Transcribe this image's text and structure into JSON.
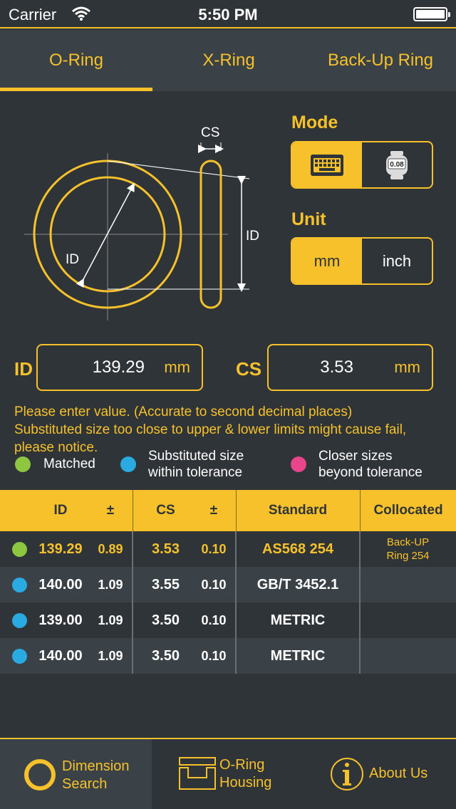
{
  "status_bar": {
    "carrier": "Carrier",
    "time": "5:50 PM"
  },
  "tabs": [
    {
      "label": "O-Ring",
      "active": true
    },
    {
      "label": "X-Ring",
      "active": false
    },
    {
      "label": "Back-Up Ring",
      "active": false
    }
  ],
  "diagram": {
    "cs_label": "CS",
    "id_label_circle": "ID",
    "id_label_side": "ID"
  },
  "mode": {
    "title": "Mode",
    "options": [
      {
        "icon": "keyboard-icon",
        "active": true
      },
      {
        "icon": "caliper-icon",
        "label": "0.08",
        "active": false
      }
    ]
  },
  "unit": {
    "title": "Unit",
    "options": [
      {
        "label": "mm",
        "active": true
      },
      {
        "label": "inch",
        "active": false
      }
    ]
  },
  "inputs": {
    "id": {
      "label": "ID",
      "value": "139.29",
      "unit": "mm"
    },
    "cs": {
      "label": "CS",
      "value": "3.53",
      "unit": "mm"
    }
  },
  "notice": {
    "line1": "Please enter value. (Accurate to second decimal places)",
    "line2": "Substituted size too close to upper & lower limits might cause fail, please notice."
  },
  "legend": [
    {
      "label": "Matched",
      "color": "#8dc63f"
    },
    {
      "label1": "Substituted size",
      "label2": "within tolerance",
      "color": "#29abe2"
    },
    {
      "label1": "Closer sizes",
      "label2": "beyond tolerance",
      "color": "#e8458b"
    }
  ],
  "table": {
    "headers": {
      "id": "ID",
      "id_tol": "±",
      "cs": "CS",
      "cs_tol": "±",
      "standard": "Standard",
      "collocated": "Collocated"
    },
    "rows": [
      {
        "dot": "#8dc63f",
        "id": "139.29",
        "id_tol": "0.89",
        "cs": "3.53",
        "cs_tol": "0.10",
        "standard": "AS568 254",
        "collocated1": "Back-UP",
        "collocated2": "Ring 254"
      },
      {
        "dot": "#29abe2",
        "id": "140.00",
        "id_tol": "1.09",
        "cs": "3.55",
        "cs_tol": "0.10",
        "standard": "GB/T 3452.1"
      },
      {
        "dot": "#29abe2",
        "id": "139.00",
        "id_tol": "1.09",
        "cs": "3.50",
        "cs_tol": "0.10",
        "standard": "METRIC"
      },
      {
        "dot": "#29abe2",
        "id": "140.00",
        "id_tol": "1.09",
        "cs": "3.50",
        "cs_tol": "0.10",
        "standard": "METRIC"
      }
    ]
  },
  "bottom_nav": {
    "dimension": {
      "line1": "Dimension",
      "line2": "Search",
      "icon": "ring-icon"
    },
    "housing": {
      "line1": "O-Ring",
      "line2": "Housing",
      "icon": "housing-icon"
    },
    "about": {
      "label": "About Us",
      "icon": "info-icon"
    }
  },
  "colors": {
    "accent": "#f6c12a",
    "background": "#2f3438",
    "panel": "#3a4247"
  }
}
